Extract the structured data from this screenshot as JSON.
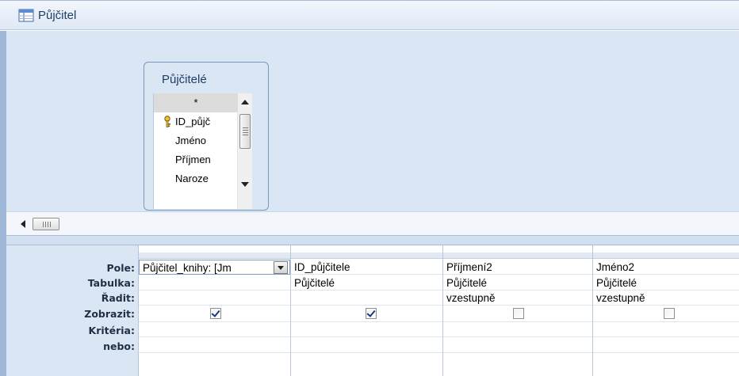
{
  "window": {
    "title": "Půjčitel"
  },
  "table": {
    "title": "Půjčitelé",
    "fields": [
      "*",
      "ID_půjč",
      "Jméno",
      "Příjmen",
      "Naroze"
    ]
  },
  "grid": {
    "row_labels": [
      "Pole:",
      "Tabulka:",
      "Řadit:",
      "Zobrazit:",
      "Kritéria:",
      "nebo:"
    ],
    "columns": [
      {
        "field": "Půjčitel_knihy: [Jm",
        "table": "",
        "sort": "",
        "show": true
      },
      {
        "field": "ID_půjčitele",
        "table": "Půjčitelé",
        "sort": "",
        "show": true
      },
      {
        "field": "Příjmení2",
        "table": "Půjčitelé",
        "sort": "vzestupně",
        "show": false
      },
      {
        "field": "Jméno2",
        "table": "Půjčitelé",
        "sort": "vzestupně",
        "show": false
      }
    ]
  },
  "colors": {
    "pane": "#dbe6f4",
    "title_text": "#1f3e66"
  }
}
